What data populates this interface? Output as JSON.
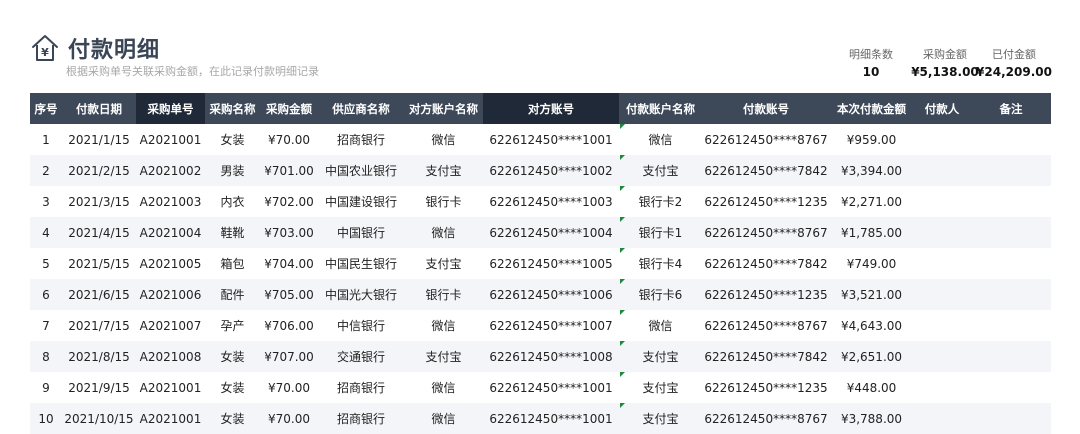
{
  "header": {
    "title": "付款明细",
    "subtitle": "根据采购单号关联采购金额，在此记录付款明细记录",
    "logo_icon": "house-yen-icon"
  },
  "summary": [
    {
      "label": "明细条数",
      "value": "10"
    },
    {
      "label": "采购金额",
      "value": "¥5,138.00"
    },
    {
      "label": "已付金额",
      "value": "¥24,209.00"
    }
  ],
  "table": {
    "columns": [
      "序号",
      "付款日期",
      "采购单号",
      "采购名称",
      "采购金额",
      "供应商名称",
      "对方账户名称",
      "对方账号",
      "付款账户名称",
      "付款账号",
      "本次付款金额",
      "付款人",
      "备注"
    ],
    "rows": [
      [
        "1",
        "2021/1/15",
        "A2021001",
        "女装",
        "¥70.00",
        "招商银行",
        "微信",
        "622612450****1001",
        "微信",
        "622612450****8767",
        "¥959.00",
        "",
        ""
      ],
      [
        "2",
        "2021/2/15",
        "A2021002",
        "男装",
        "¥701.00",
        "中国农业银行",
        "支付宝",
        "622612450****1002",
        "支付宝",
        "622612450****7842",
        "¥3,394.00",
        "",
        ""
      ],
      [
        "3",
        "2021/3/15",
        "A2021003",
        "内衣",
        "¥702.00",
        "中国建设银行",
        "银行卡",
        "622612450****1003",
        "银行卡2",
        "622612450****1235",
        "¥2,271.00",
        "",
        ""
      ],
      [
        "4",
        "2021/4/15",
        "A2021004",
        "鞋靴",
        "¥703.00",
        "中国银行",
        "微信",
        "622612450****1004",
        "银行卡1",
        "622612450****8767",
        "¥1,785.00",
        "",
        ""
      ],
      [
        "5",
        "2021/5/15",
        "A2021005",
        "箱包",
        "¥704.00",
        "中国民生银行",
        "支付宝",
        "622612450****1005",
        "银行卡4",
        "622612450****7842",
        "¥749.00",
        "",
        ""
      ],
      [
        "6",
        "2021/6/15",
        "A2021006",
        "配件",
        "¥705.00",
        "中国光大银行",
        "银行卡",
        "622612450****1006",
        "银行卡6",
        "622612450****1235",
        "¥3,521.00",
        "",
        ""
      ],
      [
        "7",
        "2021/7/15",
        "A2021007",
        "孕产",
        "¥706.00",
        "中信银行",
        "微信",
        "622612450****1007",
        "微信",
        "622612450****8767",
        "¥4,643.00",
        "",
        ""
      ],
      [
        "8",
        "2021/8/15",
        "A2021008",
        "女装",
        "¥707.00",
        "交通银行",
        "支付宝",
        "622612450****1008",
        "支付宝",
        "622612450****7842",
        "¥2,651.00",
        "",
        ""
      ],
      [
        "9",
        "2021/9/15",
        "A2021001",
        "女装",
        "¥70.00",
        "招商银行",
        "微信",
        "622612450****1001",
        "支付宝",
        "622612450****1235",
        "¥448.00",
        "",
        ""
      ],
      [
        "10",
        "2021/10/15",
        "A2021001",
        "女装",
        "¥70.00",
        "招商银行",
        "微信",
        "622612450****1001",
        "支付宝",
        "622612450****8767",
        "¥3,788.00",
        "",
        ""
      ]
    ]
  }
}
